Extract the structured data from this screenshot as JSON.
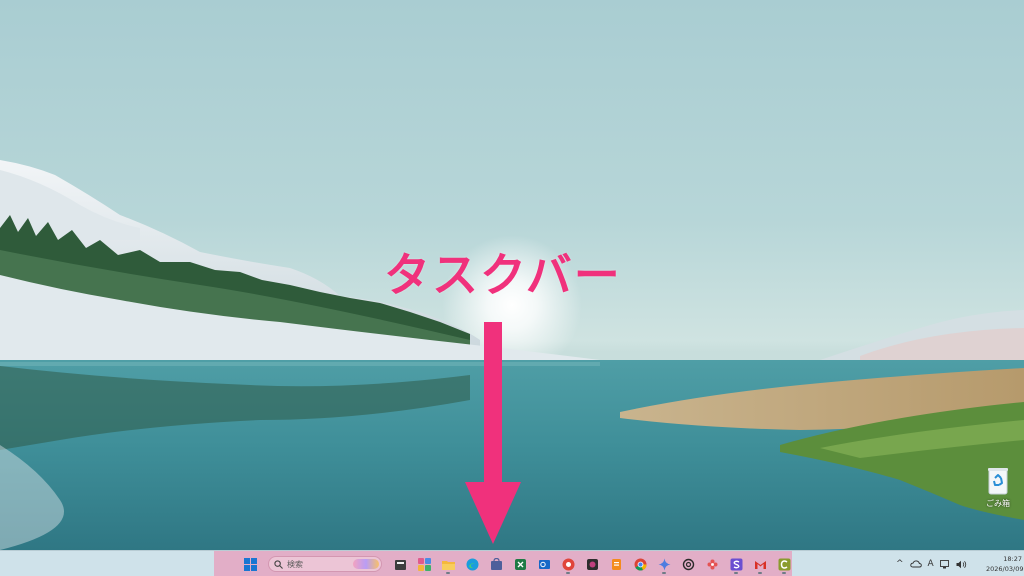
{
  "annotation": {
    "label": "タスクバー",
    "color": "#f0317c"
  },
  "desktop": {
    "icons": [
      {
        "name": "recycle-bin",
        "label": "ごみ箱"
      }
    ]
  },
  "taskbar": {
    "highlight_color": "#e4a9c3",
    "search": {
      "placeholder": "検索"
    },
    "apps": [
      {
        "icon": "start-icon",
        "running": false
      },
      {
        "icon": "file-app-icon",
        "running": false
      },
      {
        "icon": "widgets-icon",
        "running": false
      },
      {
        "icon": "file-explorer-icon",
        "running": true
      },
      {
        "icon": "edge-icon",
        "running": false
      },
      {
        "icon": "store-icon",
        "running": false
      },
      {
        "icon": "excel-icon",
        "running": false
      },
      {
        "icon": "outlook-icon",
        "running": false
      },
      {
        "icon": "red-app-icon",
        "running": true
      },
      {
        "icon": "photo-app-icon",
        "running": false
      },
      {
        "icon": "orange-app-icon",
        "running": false
      },
      {
        "icon": "chrome-icon",
        "running": false
      },
      {
        "icon": "gemini-icon",
        "running": true
      },
      {
        "icon": "chatgpt-icon",
        "running": false
      },
      {
        "icon": "pinwheel-icon",
        "running": false
      },
      {
        "icon": "s-app-icon",
        "running": true
      },
      {
        "icon": "gmail-icon",
        "running": true
      },
      {
        "icon": "c-app-icon",
        "running": true
      }
    ]
  },
  "tray": {
    "chevron": "^",
    "ime": "A",
    "time": "18:27",
    "date": "2026/03/09"
  }
}
